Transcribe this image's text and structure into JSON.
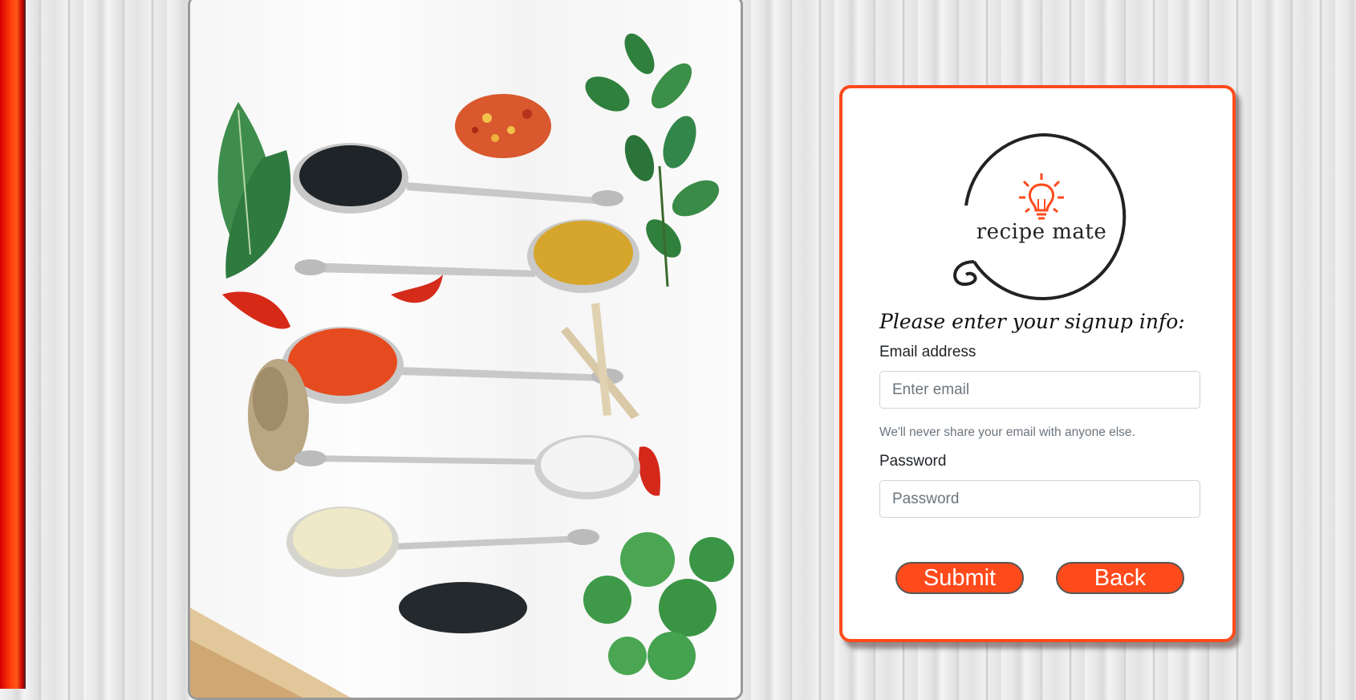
{
  "brand": {
    "name": "recipe mate",
    "icon": "lightbulb-icon"
  },
  "form": {
    "heading": "Please enter your signup info:",
    "email": {
      "label": "Email address",
      "placeholder": "Enter email",
      "value": "",
      "help": "We'll never share your email with anyone else."
    },
    "password": {
      "label": "Password",
      "placeholder": "Password",
      "value": ""
    },
    "submit_label": "Submit",
    "back_label": "Back"
  },
  "colors": {
    "accent": "#ff4a1c",
    "side_strip": "#ff2a00",
    "text": "#212529",
    "muted": "#6c757d"
  },
  "image": {
    "subject": "spices-on-spoons-photo"
  }
}
